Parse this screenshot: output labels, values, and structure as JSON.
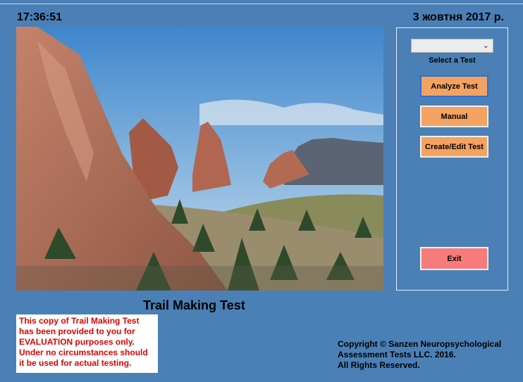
{
  "header": {
    "time": "17:36:51",
    "date": "3 жовтня 2017 р."
  },
  "panel": {
    "select_value": "",
    "select_label": "Select a Test",
    "buttons": {
      "analyze": "Analyze Test",
      "manual": "Manual",
      "create_edit": "Create/Edit Test",
      "exit": "Exit"
    }
  },
  "app_title": "Trail Making Test",
  "notice": "This copy of Trail Making Test has been provided to you for EVALUATION purposes only. Under no circumstances should it be used for actual testing.",
  "copyright": {
    "line1": "Copyright © Sanzen Neuropsychological",
    "line2": "Assessment Tests LLC. 2016.",
    "line3": "All Rights Reserved."
  },
  "colors": {
    "background": "#4a80b6",
    "button": "#f4a261",
    "exit_button": "#f77b7b",
    "notice_text": "#e00000"
  }
}
